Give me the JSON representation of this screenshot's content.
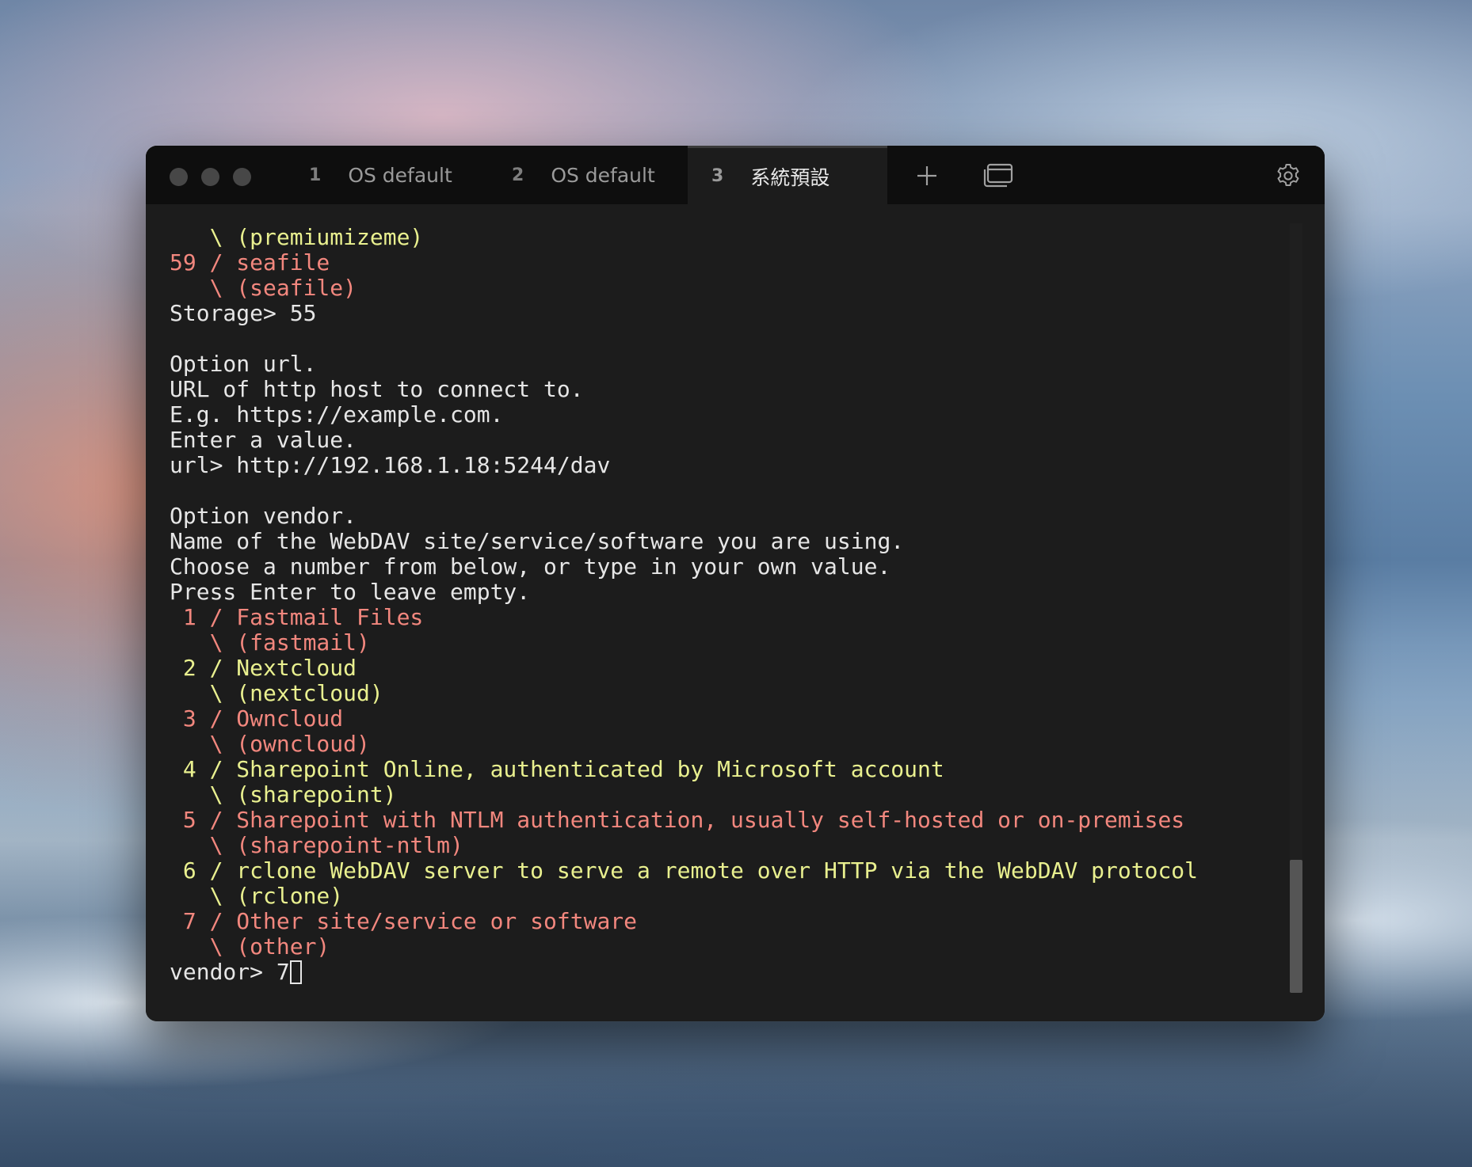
{
  "window": {
    "tabs": [
      {
        "number": "1",
        "title": "OS default",
        "active": false
      },
      {
        "number": "2",
        "title": "OS default",
        "active": false
      },
      {
        "number": "3",
        "title": "系統預設",
        "active": true
      }
    ],
    "icons": {
      "new_tab": "plus-icon",
      "windows": "windows-icon",
      "settings": "gear-icon"
    }
  },
  "colors": {
    "yellow": "#e9f08f",
    "red": "#f2877e",
    "white": "#e6e6e6",
    "background": "#1c1c1c"
  },
  "terminal": {
    "lines": [
      {
        "text": "   \\ (premiumizeme)",
        "color": "yellow"
      },
      {
        "text": "59 / seafile",
        "color": "red"
      },
      {
        "text": "   \\ (seafile)",
        "color": "red"
      },
      {
        "text": "Storage> 55",
        "color": "white"
      },
      {
        "text": "",
        "color": "white"
      },
      {
        "text": "Option url.",
        "color": "white"
      },
      {
        "text": "URL of http host to connect to.",
        "color": "white"
      },
      {
        "text": "E.g. https://example.com.",
        "color": "white"
      },
      {
        "text": "Enter a value.",
        "color": "white"
      },
      {
        "text": "url> http://192.168.1.18:5244/dav",
        "color": "white"
      },
      {
        "text": "",
        "color": "white"
      },
      {
        "text": "Option vendor.",
        "color": "white"
      },
      {
        "text": "Name of the WebDAV site/service/software you are using.",
        "color": "white"
      },
      {
        "text": "Choose a number from below, or type in your own value.",
        "color": "white"
      },
      {
        "text": "Press Enter to leave empty.",
        "color": "white"
      },
      {
        "text": " 1 / Fastmail Files",
        "color": "red"
      },
      {
        "text": "   \\ (fastmail)",
        "color": "red"
      },
      {
        "text": " 2 / Nextcloud",
        "color": "yellow"
      },
      {
        "text": "   \\ (nextcloud)",
        "color": "yellow"
      },
      {
        "text": " 3 / Owncloud",
        "color": "red"
      },
      {
        "text": "   \\ (owncloud)",
        "color": "red"
      },
      {
        "text": " 4 / Sharepoint Online, authenticated by Microsoft account",
        "color": "yellow"
      },
      {
        "text": "   \\ (sharepoint)",
        "color": "yellow"
      },
      {
        "text": " 5 / Sharepoint with NTLM authentication, usually self-hosted or on-premises",
        "color": "red"
      },
      {
        "text": "   \\ (sharepoint-ntlm)",
        "color": "red"
      },
      {
        "text": " 6 / rclone WebDAV server to serve a remote over HTTP via the WebDAV protocol",
        "color": "yellow"
      },
      {
        "text": "   \\ (rclone)",
        "color": "yellow"
      },
      {
        "text": " 7 / Other site/service or software",
        "color": "red"
      },
      {
        "text": "   \\ (other)",
        "color": "red"
      }
    ],
    "prompt": "vendor> 7"
  }
}
